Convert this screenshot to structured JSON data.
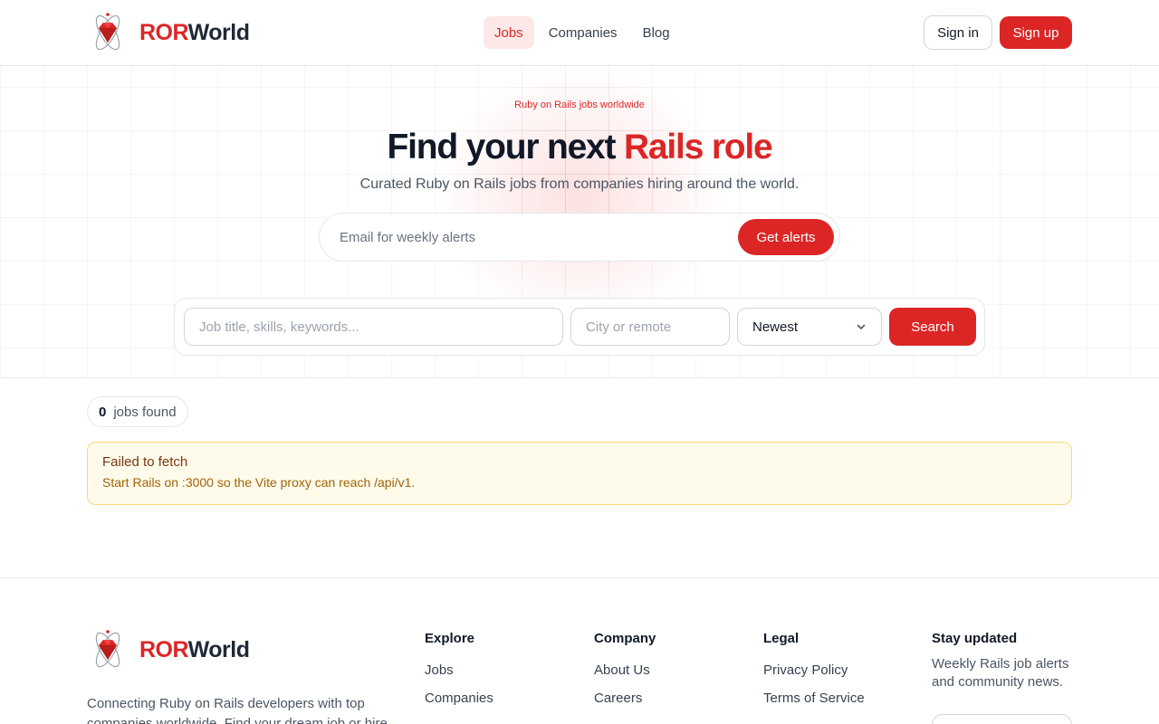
{
  "brand": {
    "name_accent": "ROR",
    "name_rest": "World"
  },
  "nav": {
    "items": [
      {
        "label": "Jobs",
        "active": true
      },
      {
        "label": "Companies",
        "active": false
      },
      {
        "label": "Blog",
        "active": false
      }
    ],
    "signin_label": "Sign in",
    "signup_label": "Sign up"
  },
  "hero": {
    "eyebrow": "Ruby on Rails jobs worldwide",
    "headline_main": "Find your next ",
    "headline_accent": "Rails role",
    "subhead": "Curated Ruby on Rails jobs from companies hiring around the world.",
    "alert_placeholder": "Email for weekly alerts",
    "alert_button": "Get alerts"
  },
  "search": {
    "keywords_placeholder": "Job title, skills, keywords...",
    "location_placeholder": "City or remote",
    "sort_value": "Newest",
    "button_label": "Search"
  },
  "results": {
    "count": "0",
    "count_label": "jobs found",
    "error_title": "Failed to fetch",
    "error_message": "Start Rails on :3000 so the Vite proxy can reach /api/v1."
  },
  "footer": {
    "description": "Connecting Ruby on Rails developers with top companies worldwide. Find your dream job or hire",
    "explore": {
      "title": "Explore",
      "links": [
        "Jobs",
        "Companies"
      ]
    },
    "company": {
      "title": "Company",
      "links": [
        "About Us",
        "Careers"
      ]
    },
    "legal": {
      "title": "Legal",
      "links": [
        "Privacy Policy",
        "Terms of Service"
      ]
    },
    "newsletter": {
      "title": "Stay updated",
      "note": "Weekly Rails job alerts and community news."
    }
  },
  "colors": {
    "accent": "#dc2626",
    "text": "#111827",
    "muted": "#4b5563",
    "warning_bg": "#fffbeb",
    "warning_border": "#f5d77a"
  }
}
